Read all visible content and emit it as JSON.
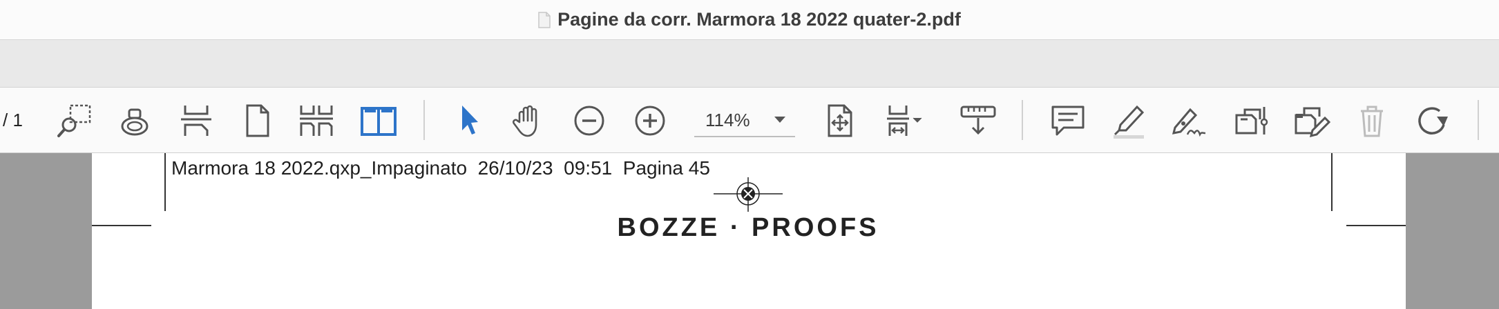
{
  "window": {
    "title": "Pagine da corr. Marmora 18 2022 quater-2.pdf",
    "title_icon": "document-icon"
  },
  "toolbar": {
    "page_count": "/ 1",
    "zoom_value": "114%",
    "tools": [
      {
        "name": "marquee-zoom",
        "icon": "marquee-zoom-icon"
      },
      {
        "name": "ink-saver",
        "icon": "ink-bottle-icon"
      },
      {
        "name": "page-break",
        "icon": "page-break-icon"
      },
      {
        "name": "single-page",
        "icon": "single-page-icon"
      },
      {
        "name": "continuous-pages",
        "icon": "continuous-pages-icon"
      },
      {
        "name": "two-page",
        "icon": "two-page-icon",
        "active": true
      },
      {
        "name": "select",
        "icon": "arrow-pointer-icon",
        "active": true
      },
      {
        "name": "hand",
        "icon": "hand-icon"
      },
      {
        "name": "zoom-out",
        "icon": "zoom-out-icon"
      },
      {
        "name": "zoom-in",
        "icon": "zoom-in-icon"
      },
      {
        "name": "fit-page",
        "icon": "fit-page-icon"
      },
      {
        "name": "fit-width",
        "icon": "fit-width-icon"
      },
      {
        "name": "ruler-measure",
        "icon": "ruler-icon"
      },
      {
        "name": "comment",
        "icon": "comment-icon"
      },
      {
        "name": "highlight",
        "icon": "highlighter-icon"
      },
      {
        "name": "sign",
        "icon": "signature-pen-icon"
      },
      {
        "name": "form-field",
        "icon": "form-field-icon"
      },
      {
        "name": "edit-text",
        "icon": "edit-document-icon"
      },
      {
        "name": "delete",
        "icon": "trash-icon"
      },
      {
        "name": "rotate",
        "icon": "rotate-icon"
      }
    ],
    "accent_color": "#2d74c9"
  },
  "document": {
    "slug_line": "Marmora 18 2022.qxp_Impaginato  26/10/23  09:51  Pagina 45",
    "heading": "BOZZE · PROOFS"
  }
}
